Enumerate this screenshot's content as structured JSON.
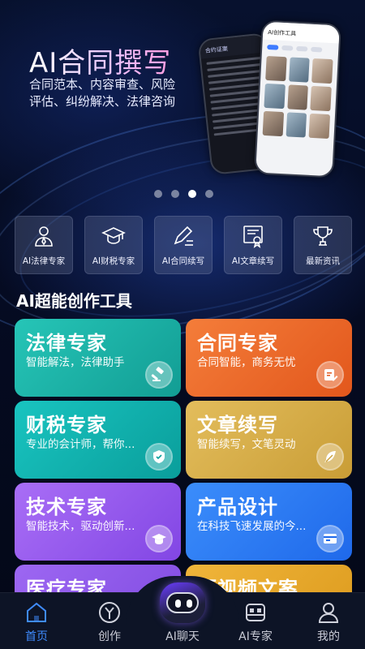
{
  "banner": {
    "title": "AI合同撰写",
    "subtitle": "合同范本、内容审查、风险评估、纠纷解决、法律咨询",
    "phone_back_header": "合约证案",
    "phone_front_header": "AI创作工具",
    "active_slide": 3,
    "slide_count": 4
  },
  "quick_nav": [
    {
      "label": "AI法律专家",
      "icon": "lawyer-icon"
    },
    {
      "label": "AI财税专家",
      "icon": "graduation-cap-icon"
    },
    {
      "label": "AI合同续写",
      "icon": "pen-write-icon"
    },
    {
      "label": "AI文章续写",
      "icon": "certificate-icon"
    },
    {
      "label": "最新资讯",
      "icon": "trophy-icon"
    }
  ],
  "section_title": "AI超能创作工具",
  "tools": [
    {
      "title": "法律专家",
      "desc": "智能解法，法律助手",
      "icon": "gavel-icon",
      "color": "#1eb4a8"
    },
    {
      "title": "合同专家",
      "desc": "合同智能，商务无忧",
      "icon": "contract-edit-icon",
      "color": "#f06a2b"
    },
    {
      "title": "财税专家",
      "desc": "专业的会计师，帮你...",
      "icon": "shield-icon",
      "color": "#12b6b2"
    },
    {
      "title": "文章续写",
      "desc": "智能续写，文笔灵动",
      "icon": "feather-icon",
      "color": "#d9b14d"
    },
    {
      "title": "技术专家",
      "desc": "智能技术，驱动创新...",
      "icon": "graduation-cap-icon",
      "color": "#9a5ff0"
    },
    {
      "title": "产品设计",
      "desc": "在科技飞速发展的今...",
      "icon": "card-icon",
      "color": "#2f7ff7"
    },
    {
      "title": "医疗专家",
      "desc": "",
      "icon": "",
      "color": "#8c5ff0"
    },
    {
      "title": "短视频文案",
      "desc": "",
      "icon": "",
      "color": "#e9a82a"
    }
  ],
  "tabbar": [
    {
      "label": "首页",
      "icon": "home-icon",
      "active": true
    },
    {
      "label": "创作",
      "icon": "create-icon",
      "active": false
    },
    {
      "label": "AI聊天",
      "icon": "robot-icon",
      "active": false
    },
    {
      "label": "AI专家",
      "icon": "expert-icon",
      "active": false
    },
    {
      "label": "我的",
      "icon": "user-icon",
      "active": false
    }
  ],
  "colors": {
    "accent": "#3f8cff",
    "background": "#050b1f"
  }
}
